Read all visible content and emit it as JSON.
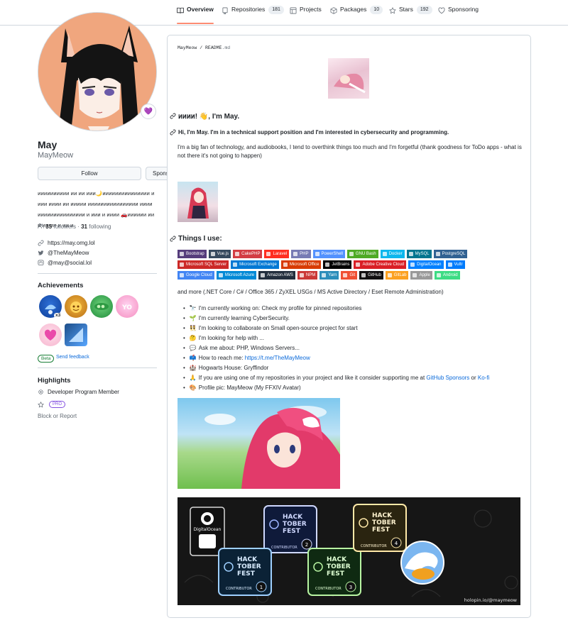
{
  "tabs": [
    {
      "label": "Overview",
      "count": null,
      "icon": "book-icon",
      "selected": true
    },
    {
      "label": "Repositories",
      "count": "181",
      "icon": "repo-icon"
    },
    {
      "label": "Projects",
      "count": null,
      "icon": "table-icon"
    },
    {
      "label": "Packages",
      "count": "10",
      "icon": "package-icon"
    },
    {
      "label": "Stars",
      "count": "192",
      "icon": "star-icon"
    },
    {
      "label": "Sponsoring",
      "count": null,
      "icon": "heart-icon"
    }
  ],
  "profile": {
    "name": "May",
    "login": "MayMeow",
    "status_emoji": "💜",
    "follow_label": "Follow",
    "sponsor_label": "Sponsor",
    "bio": "𐑍𐑍𐑍𐑍𐑍𐑍𐑍𐑍𐑍𐑍 𐑍𐑍 𐑍𐑍 𐑍𐑍𐑍🌙𐑍𐑍𐑍𐑍𐑍𐑍𐑍𐑍𐑍𐑍𐑍𐑍𐑍𐑍𐑍 𐑍𐑍𐑍𐑍 𐑍𐑍𐑍𐑍 𐑍𐑍 𐑍𐑍𐑍𐑍𐑍 𐑍𐑍𐑍𐑍𐑍𐑍𐑍𐑍𐑍𐑍𐑍𐑍𐑍𐑍𐑍𐑍 𐑍𐑍𐑍𐑍𐑍𐑍𐑍𐑍𐑍𐑍𐑍𐑍𐑍𐑍𐑍𐑍𐑍𐑍𐑍 𐑍 𐑍𐑍𐑍 𐑍 𐑍𐑍𐑍𐑍 🚗𐑍𐑍𐑍𐑍𐑍𐑍 𐑍𐑍 𐑍 𐑍𐑍 𐑍𐑍 𐑍 𐑍𐑍 𐑍",
    "followers": "35",
    "followers_label": "followers",
    "following": "31",
    "following_label": "following",
    "dot": "·",
    "website": "https://may.omg.lol",
    "twitter": "@TheMayMeow",
    "mastodon": "@may@social.lol"
  },
  "achievements": {
    "title": "Achievements",
    "multiplier": "x3",
    "beta_label": "Beta",
    "feedback_label": "Send feedback"
  },
  "highlights": {
    "title": "Highlights",
    "member": "Developer Program Member",
    "pro": "PRO",
    "block": "Block or Report"
  },
  "readme": {
    "owner": "MayMeow",
    "slash": " / ",
    "file": "README",
    "ext": ".md",
    "greeting": "𐑍𐑍𐑍𐑍! 👋, I'm May.",
    "subheading": "Hi, I'm May. I'm in a technical support position and I'm interested in cybersecurity and programming.",
    "intro": "I'm a big fan of technology, and audiobooks, I tend to overthink things too much and I'm forgetful (thank goodness for ToDo apps - what is not there it's not going to happen)",
    "things_heading": "Things I use:",
    "more": "and more (.NET Core / C# / Office 365 / ZyXEL USGs / MS Active Directory / Eset Remote Administration)",
    "shields": [
      [
        {
          "label": "Bootstrap",
          "color": "#563d7c"
        },
        {
          "label": "Vue.js",
          "color": "#35495e"
        },
        {
          "label": "CakePHP",
          "color": "#d33c43"
        },
        {
          "label": "Laravel",
          "color": "#ff2d20"
        },
        {
          "label": "PHP",
          "color": "#777bb4"
        },
        {
          "label": "PowerShell",
          "color": "#5391fe"
        },
        {
          "label": "GNU Bash",
          "color": "#4eaa25"
        },
        {
          "label": "Docker",
          "color": "#0db7ed"
        },
        {
          "label": "MySQL",
          "color": "#00758f"
        },
        {
          "label": "PostgreSQL",
          "color": "#316192"
        }
      ],
      [
        {
          "label": "Microsoft SQL Server",
          "color": "#cc2927"
        },
        {
          "label": "Microsoft Exchange",
          "color": "#0078d4"
        },
        {
          "label": "Microsoft Office",
          "color": "#d83b01"
        },
        {
          "label": "JetBrains",
          "color": "#000000"
        },
        {
          "label": "Adobe Creative Cloud",
          "color": "#da1f26"
        },
        {
          "label": "DigitalOcean",
          "color": "#0080ff"
        },
        {
          "label": "Vultr",
          "color": "#007bfc"
        }
      ],
      [
        {
          "label": "Google Cloud",
          "color": "#4285f4"
        },
        {
          "label": "Microsoft Azure",
          "color": "#0089d6"
        },
        {
          "label": "Amazon AWS",
          "color": "#232f3e"
        },
        {
          "label": "NPM",
          "color": "#cb3837"
        },
        {
          "label": "Yarn",
          "color": "#2c8ebb"
        },
        {
          "label": "Git",
          "color": "#f05033"
        },
        {
          "label": "GitHub",
          "color": "#121011"
        },
        {
          "label": "GitLab",
          "color": "#fca121"
        },
        {
          "label": "Apple",
          "color": "#999999"
        },
        {
          "label": "Android",
          "color": "#3ddc84"
        }
      ]
    ],
    "list": [
      {
        "emoji": "🔭",
        "text": "I'm currently working on: Check my profile for pinned repositories"
      },
      {
        "emoji": "🌱",
        "text": "I'm currently learning CyberSecurity."
      },
      {
        "emoji": "👯",
        "text": "I'm looking to collaborate on Small open-source project for start"
      },
      {
        "emoji": "🤔",
        "text": "I'm looking for help with ..."
      },
      {
        "emoji": "💬",
        "text": "Ask me about: PHP, Windows Servers..."
      },
      {
        "emoji": "📫",
        "text": "How to reach me: ",
        "link": "https://t.me/TheMayMeow"
      },
      {
        "emoji": "🏰",
        "text": "Hogwarts House: Gryffindor"
      },
      {
        "emoji": "🙏",
        "text": "If you are using one of my repositories in your project and like it consider supporting me at ",
        "link": "GitHub Sponsors",
        "mid": " or ",
        "link2": "Ko-fi"
      },
      {
        "emoji": "🎨",
        "text": "Profile pic: MayMeow (My FFXIV Avatar)"
      }
    ],
    "holopin_credit": "holopin.io/@maymeow",
    "hacktoberfest": {
      "digitalocean": "DigitalOcean",
      "title_line1": "HACK",
      "title_line2": "TOBER",
      "title_line3": "FEST",
      "contributor": "CONTRIBUTOR",
      "levels": [
        "1",
        "2",
        "3",
        "4"
      ]
    }
  },
  "colors": {
    "accent": "#0969da",
    "tab_underline": "#fd8c73",
    "avatar_bg": "#f0a67e",
    "border": "#d0d7de"
  }
}
